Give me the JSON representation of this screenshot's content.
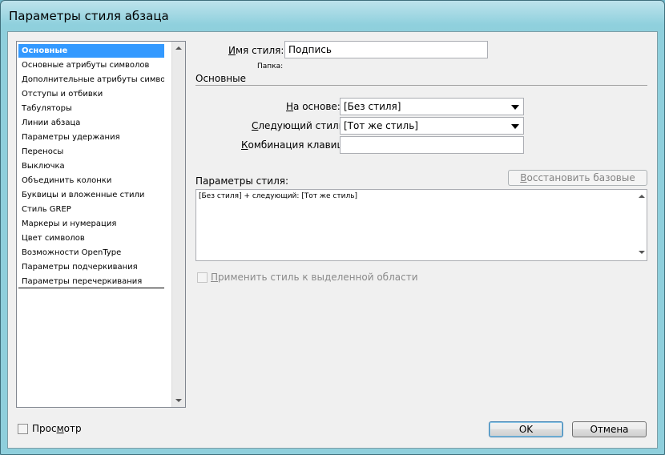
{
  "window": {
    "title": "Параметры стиля абзаца"
  },
  "sidebar": {
    "items": [
      {
        "label": "Основные",
        "selected": true
      },
      {
        "label": "Основные атрибуты символов"
      },
      {
        "label": "Дополнительные атрибуты символов"
      },
      {
        "label": "Отступы и отбивки"
      },
      {
        "label": "Табуляторы"
      },
      {
        "label": "Линии абзаца"
      },
      {
        "label": "Параметры удержания"
      },
      {
        "label": "Переносы"
      },
      {
        "label": "Выключка"
      },
      {
        "label": "Объединить колонки"
      },
      {
        "label": "Буквицы и вложенные стили"
      },
      {
        "label": "Стиль GREP"
      },
      {
        "label": "Маркеры и нумерация"
      },
      {
        "label": "Цвет символов"
      },
      {
        "label": "Возможности OpenType"
      },
      {
        "label": "Параметры подчеркивания"
      },
      {
        "label": "Параметры перечеркивания"
      }
    ]
  },
  "form": {
    "style_name_label": "Имя стиля:",
    "style_name_value": "Подпись",
    "folder_label": "Папка:",
    "section_title": "Основные",
    "based_on_label": "На основе:",
    "based_on_value": "[Без стиля]",
    "next_style_label": "Следующий стиль:",
    "next_style_value": "[Тот же стиль]",
    "shortcut_label": "Комбинация клавиш:",
    "shortcut_value": "",
    "style_settings_label": "Параметры стиля:",
    "reset_button": "Восстановить базовые",
    "style_settings_text": "[Без стиля] + следующий: [Тот же стиль]",
    "apply_checkbox_label": "Применить стиль к выделенной области"
  },
  "footer": {
    "preview_label": "Просмотр",
    "ok_label": "OK",
    "cancel_label": "Отмена"
  }
}
